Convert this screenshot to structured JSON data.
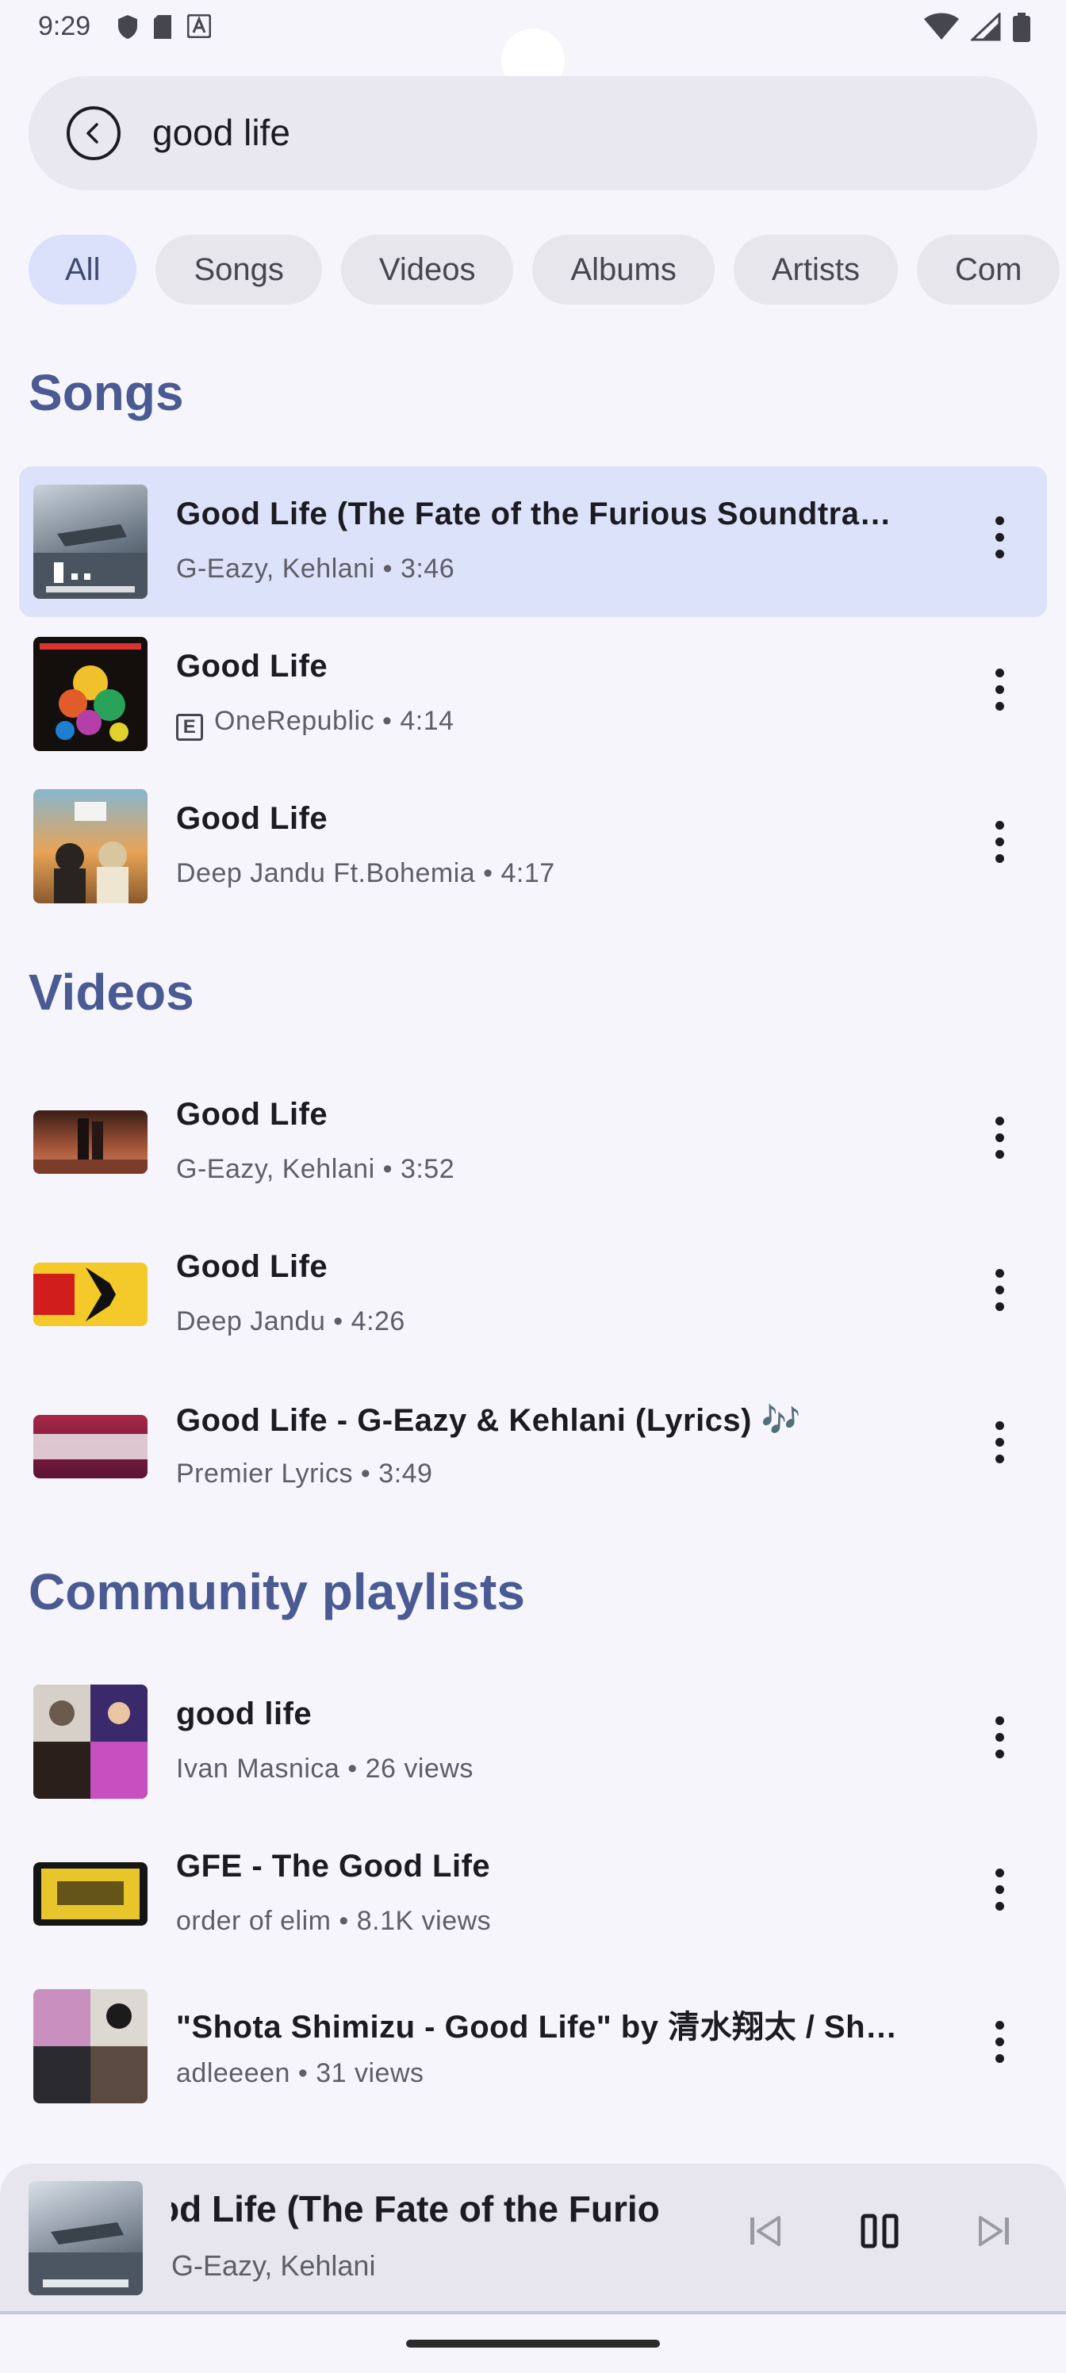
{
  "status": {
    "time": "9:29"
  },
  "search": {
    "query": "good life"
  },
  "filters": [
    "All",
    "Songs",
    "Videos",
    "Albums",
    "Artists",
    "Com"
  ],
  "sections": {
    "songs_title": "Songs",
    "videos_title": "Videos",
    "playlists_title": "Community playlists"
  },
  "songs": [
    {
      "title": "Good Life (The Fate of the Furious Soundtra…",
      "subtitle": "G-Eazy, Kehlani • 3:46"
    },
    {
      "title": "Good Life",
      "subtitle": "OneRepublic • 4:14",
      "explicit": "E"
    },
    {
      "title": "Good Life",
      "subtitle": "Deep Jandu Ft.Bohemia • 4:17"
    }
  ],
  "videos": [
    {
      "title": "Good Life",
      "subtitle": "G-Eazy, Kehlani • 3:52"
    },
    {
      "title": "Good Life",
      "subtitle": "Deep Jandu • 4:26"
    },
    {
      "title": "Good Life - G-Eazy & Kehlani (Lyrics) 🎶",
      "subtitle": "Premier Lyrics • 3:49"
    }
  ],
  "playlists": [
    {
      "title": "good life",
      "subtitle": "Ivan Masnica • 26 views"
    },
    {
      "title": "GFE - The Good Life",
      "subtitle": "order of elim • 8.1K views"
    },
    {
      "title": "\"Shota Shimizu - Good Life\" by 清水翔太 / Sh…",
      "subtitle": "adleeeen • 31 views"
    }
  ],
  "now_playing": {
    "title": "od Life (The Fate of the Furio",
    "artist": "G-Eazy, Kehlani"
  },
  "colors": {
    "accent": "#4a5a92",
    "highlight": "#dde2fb",
    "chip_selected": "#dbe1fa"
  },
  "icons": [
    "back-arrow-icon",
    "more-vert-icon",
    "skip-previous-icon",
    "pause-icon",
    "skip-next-icon"
  ]
}
